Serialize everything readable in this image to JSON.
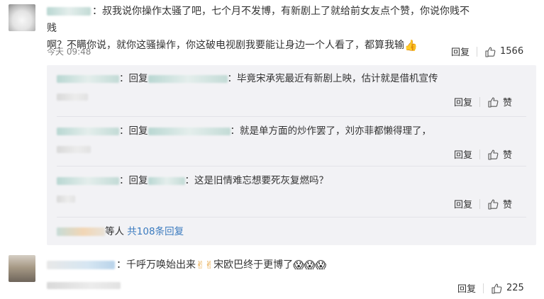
{
  "comment1": {
    "text_line1": "：叔我说你操作太骚了吧，七个月不发博，有新剧上了就给前女友点个赞，你说你贱不贱",
    "text_line2": "啊？不瞒你说，就你这骚操作，你这破电视剧我要能让身边一个人看了，都算我输",
    "emoji": "👍",
    "time": "今天 09:48",
    "reply_label": "回复",
    "like_count": "1566"
  },
  "replies": [
    {
      "prefix": "：回复",
      "text": "：毕竟宋承宪最近有新剧上映，估计就是借机宣传",
      "reply_label": "回复",
      "like_label": "赞"
    },
    {
      "prefix": "：回复",
      "text": "：就是单方面的炒作罢了，刘亦菲都懒得理了，",
      "reply_label": "回复",
      "like_label": "赞"
    },
    {
      "prefix": "：回复",
      "text": "：这是旧情难忘想要死灰复燃吗？",
      "reply_label": "回复",
      "like_label": "赞"
    }
  ],
  "more_replies": {
    "suffix": "等人",
    "link": "共108条回复"
  },
  "comment2": {
    "text_a": "：千呼万唤始出来",
    "emoji_a": "✌✌",
    "text_b": "宋欧巴终于更博了",
    "emoji_b": "😱😱😱",
    "reply_label": "回复",
    "like_count": "225"
  },
  "colors": {
    "link": "#3b7bbf",
    "reply_bg": "#f2f2f5",
    "divider": "#e3e3e8"
  },
  "icons": {
    "like": "thumbs-up-icon"
  }
}
